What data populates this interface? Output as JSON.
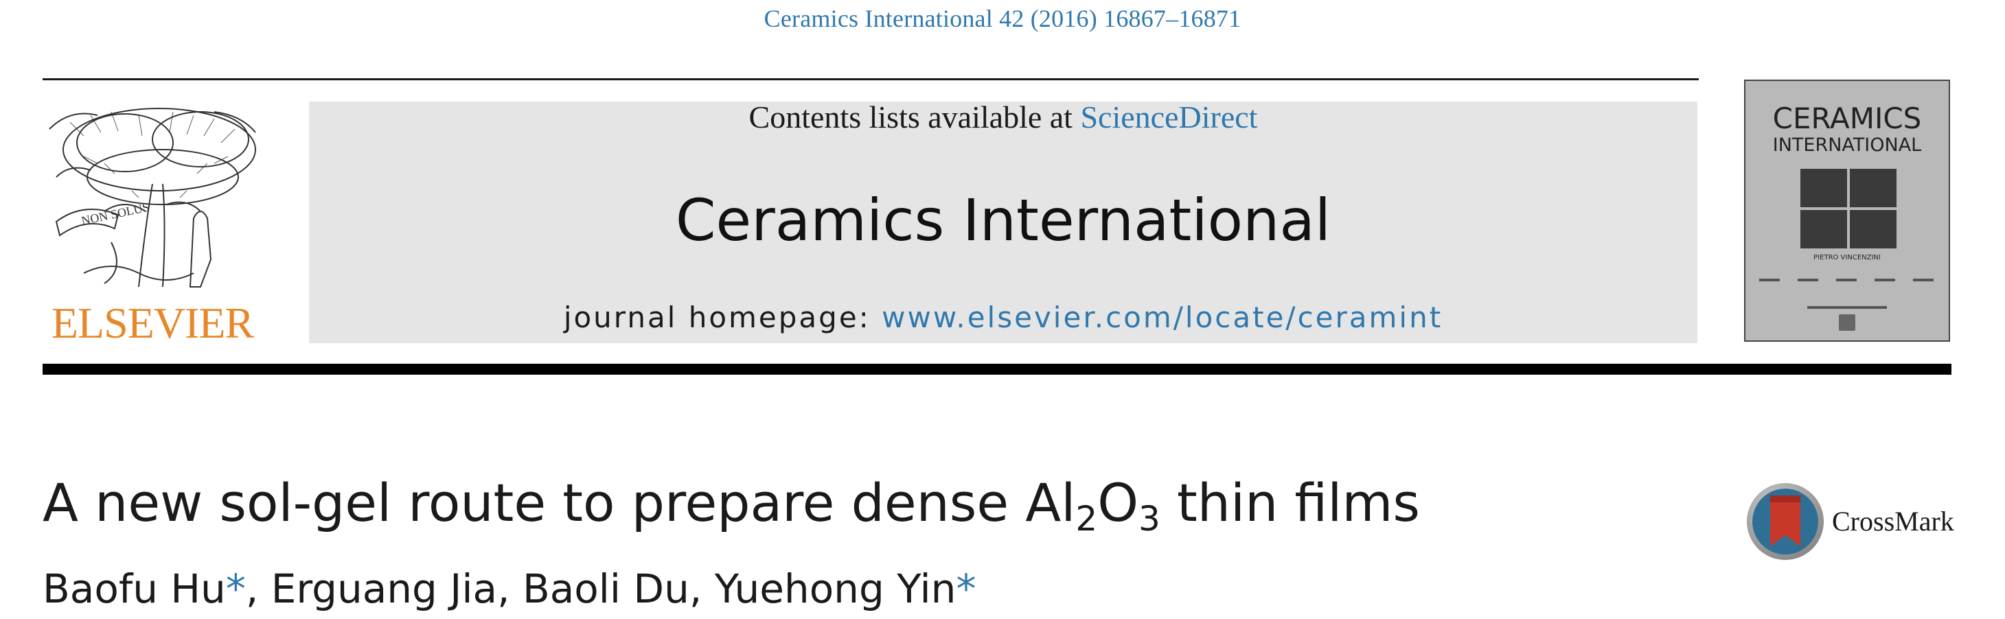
{
  "header": {
    "citation": "Ceramics International 42 (2016) 16867–16871"
  },
  "publisher": {
    "wordmark": "ELSEVIER",
    "motto": "NON SOLUS",
    "brand_color": "#e8872a"
  },
  "banner": {
    "contents_prefix": "Contents lists available at ",
    "contents_link": "ScienceDirect",
    "journal_name": "Ceramics International",
    "homepage_prefix": "journal homepage: ",
    "homepage_link": "www.elsevier.com/locate/ceramint",
    "link_color": "#2f78ad"
  },
  "cover": {
    "title_line1": "CERAMICS",
    "title_line2": "INTERNATIONAL",
    "editor": "PIETRO VINCENZINI"
  },
  "article": {
    "title_pre": "A new sol-gel route to prepare dense Al",
    "title_sub1": "2",
    "title_mid": "O",
    "title_sub2": "3",
    "title_post": " thin films",
    "authors": [
      {
        "name": "Baofu Hu",
        "star": "*",
        "sep": ", "
      },
      {
        "name": "Erguang Jia",
        "star": "",
        "sep": ", "
      },
      {
        "name": "Baoli Du",
        "star": "",
        "sep": ", "
      },
      {
        "name": "Yuehong Yin",
        "star": "*",
        "sep": ""
      }
    ]
  },
  "crossmark": {
    "label": "CrossMark",
    "icon": "crossmark-icon"
  }
}
